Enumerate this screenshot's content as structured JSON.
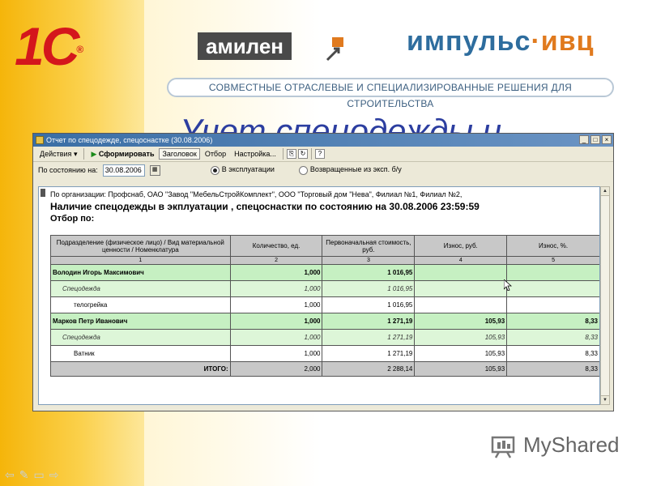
{
  "slide": {
    "brand_1c": "1С",
    "brand_1c_reg": "®",
    "amilen": "амилен",
    "impuls_main": "импульс",
    "impuls_dot": "·",
    "impuls_ivc": "ивц",
    "banner": "СОВМЕСТНЫЕ ОТРАСЛЕВЫЕ И СПЕЦИАЛИЗИРОВАННЫЕ РЕШЕНИЯ ДЛЯ СТРОИТЕЛЬСТВА",
    "title": "Учет спецодежды и",
    "watermark": "MyShared",
    "nav_icons": [
      "back-icon",
      "edit-icon",
      "menu-icon",
      "forward-icon"
    ]
  },
  "window": {
    "title": "Отчет по спецодежде, спецоснастке (30.08.2006)",
    "controls": [
      "_",
      "□",
      "×"
    ]
  },
  "toolbar": {
    "actions": "Действия",
    "generate": "Сформировать",
    "header": "Заголовок",
    "filter": "Отбор",
    "settings": "Настройка...",
    "help": "?"
  },
  "params": {
    "as_of_label": "По состоянию на:",
    "as_of_value": "30.08.2006",
    "radio_in_use": "В эксплуатации",
    "radio_returned": "Возвращенные из эксп. б/у"
  },
  "report": {
    "org_line": "По организации: Профснаб, ОАО \"Завод \"МебельСтройКомплект\", ООО \"Торговый дом \"Нева\", Филиал №1, Филиал №2,",
    "title": "Наличие спецодежды  в экплуатации , спецоснастки по состоянию на 30.08.2006 23:59:59",
    "filter": "Отбор по:",
    "columns": [
      "Подразделение (физическое лицо) / Вид материальной ценности / Номенклатура",
      "Количество, ед.",
      "Первоначальная стоимость, руб.",
      "Износ, руб.",
      "Износ, %."
    ],
    "column_numbers": [
      "1",
      "2",
      "3",
      "4",
      "5"
    ],
    "rows": [
      {
        "kind": "person",
        "name": "Володин Игорь Максимович",
        "qty": "1,000",
        "cost": "1 016,95",
        "wear": "",
        "wear_pct": ""
      },
      {
        "kind": "group",
        "name": "Спецодежда",
        "qty": "1,000",
        "cost": "1 016,95",
        "wear": "",
        "wear_pct": ""
      },
      {
        "kind": "item",
        "name": "телогрейка",
        "qty": "1,000",
        "cost": "1 016,95",
        "wear": "",
        "wear_pct": ""
      },
      {
        "kind": "person",
        "name": "Марков Петр Иванович",
        "qty": "1,000",
        "cost": "1 271,19",
        "wear": "105,93",
        "wear_pct": "8,33"
      },
      {
        "kind": "group",
        "name": "Спецодежда",
        "qty": "1,000",
        "cost": "1 271,19",
        "wear": "105,93",
        "wear_pct": "8,33"
      },
      {
        "kind": "item",
        "name": "Ватник",
        "qty": "1,000",
        "cost": "1 271,19",
        "wear": "105,93",
        "wear_pct": "8,33"
      },
      {
        "kind": "total",
        "name": "ИТОГО:",
        "qty": "2,000",
        "cost": "2 288,14",
        "wear": "105,93",
        "wear_pct": "8,33"
      }
    ]
  },
  "colors": {
    "person_row": "#c6f0c2",
    "group_row": "#ddf6d8",
    "header_gray": "#c8c8c8",
    "title_blue": "#2c3ea0",
    "brand_red": "#d4161c"
  }
}
